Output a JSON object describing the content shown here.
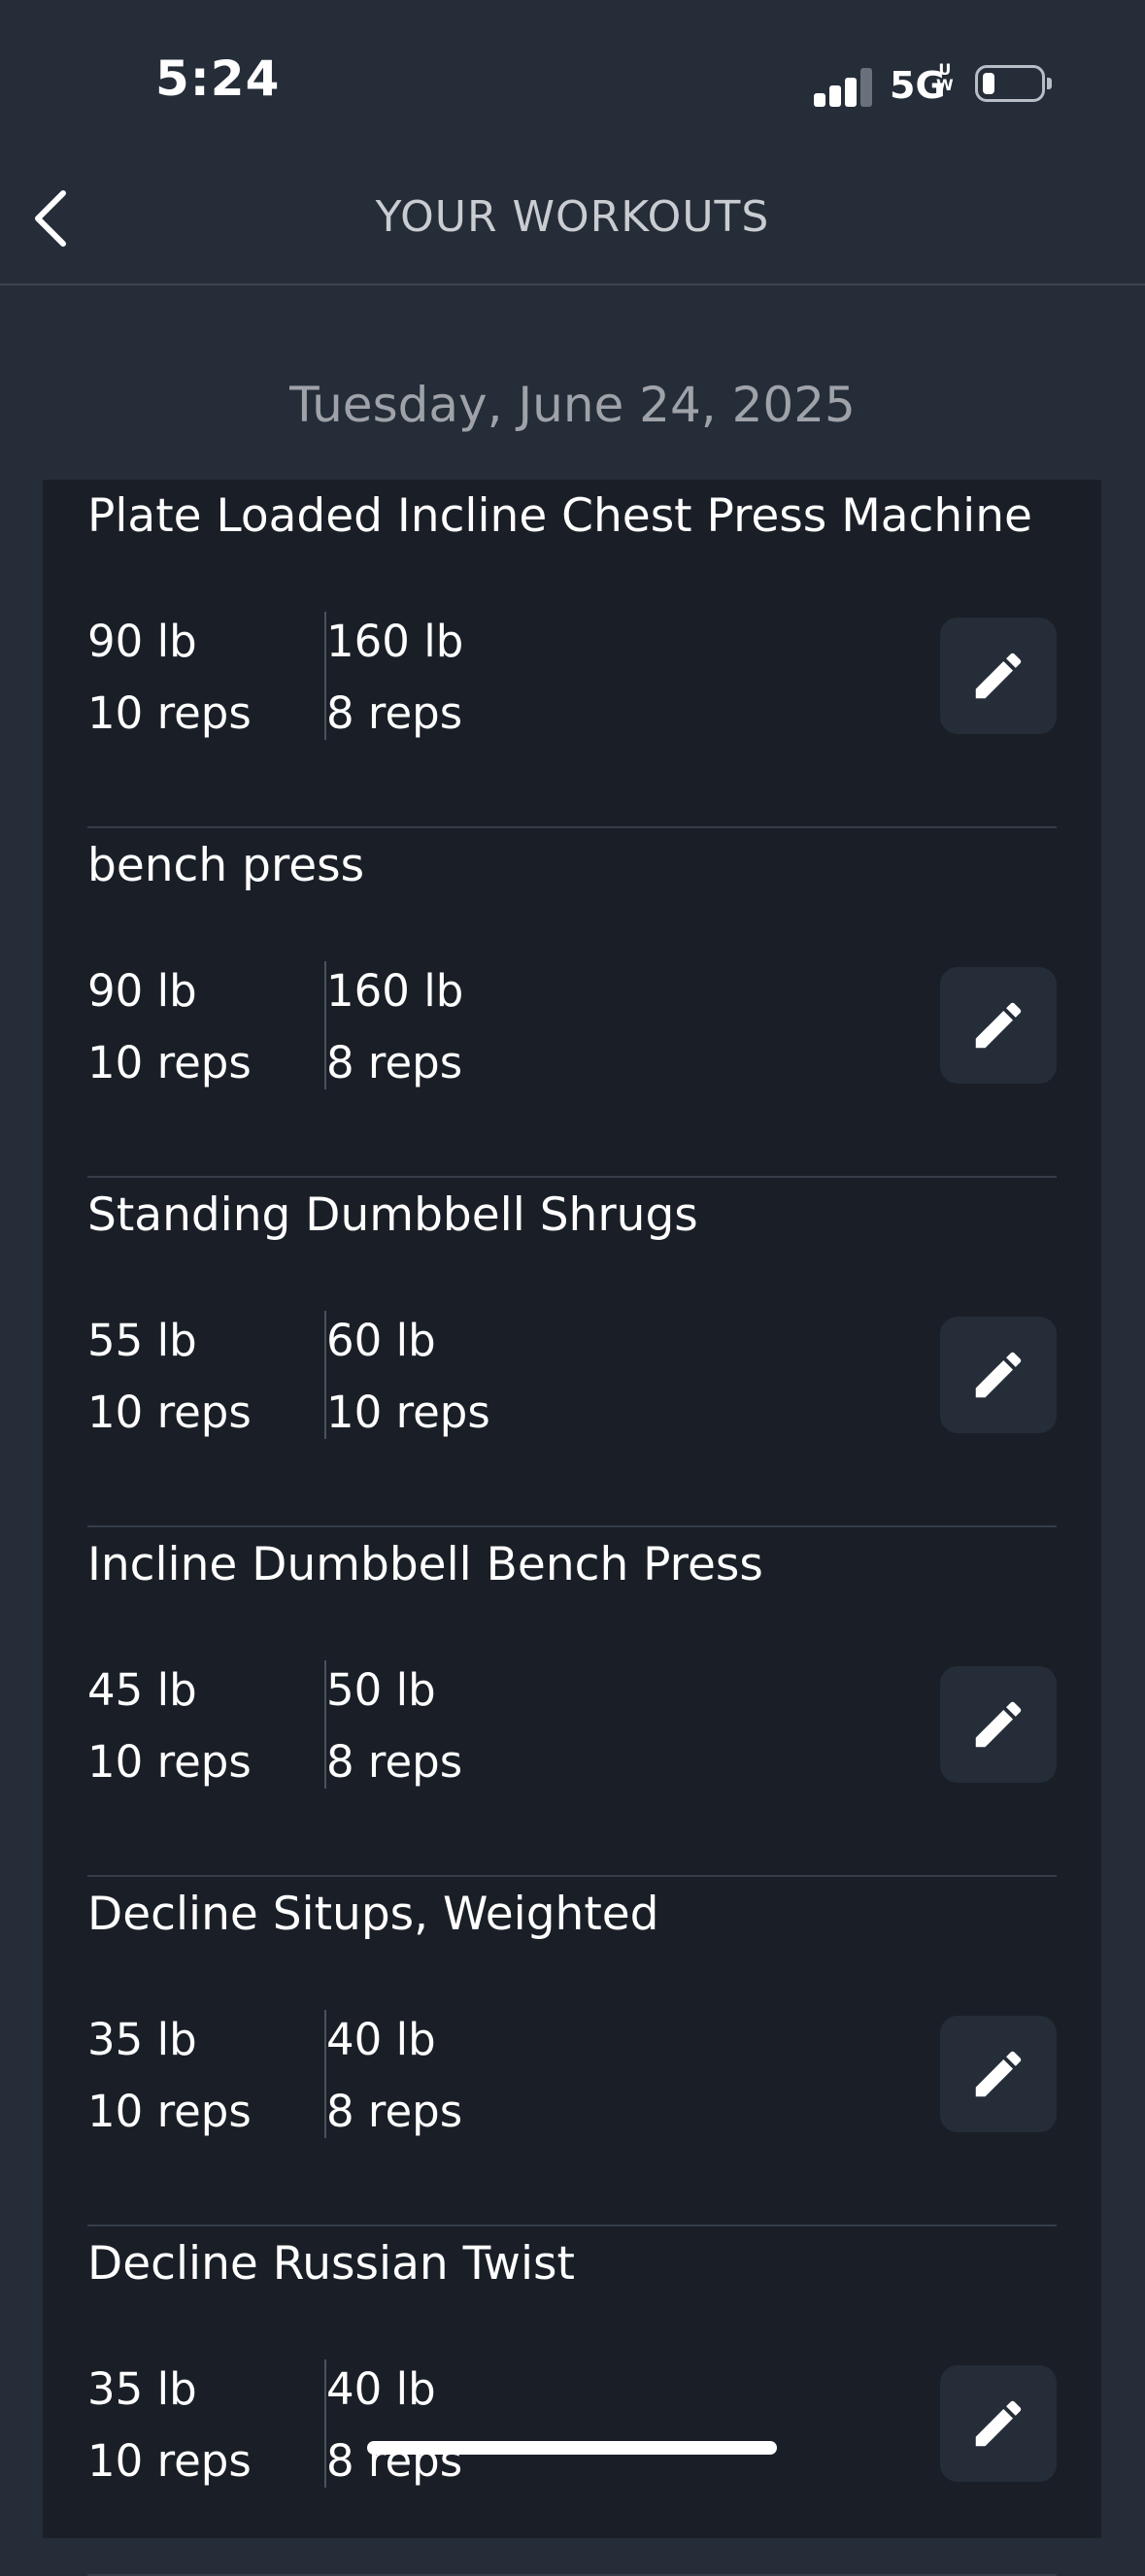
{
  "status_bar": {
    "time": "5:24",
    "network": "5G",
    "network_sup": "U\nW"
  },
  "nav": {
    "title": "YOUR WORKOUTS"
  },
  "date_header": "Tuesday, June 24, 2025",
  "workouts": [
    {
      "name": "Plate Loaded Incline Chest Press Machine",
      "sets": [
        {
          "weight": "90 lb",
          "reps": "10 reps"
        },
        {
          "weight": "160 lb",
          "reps": "8 reps"
        }
      ]
    },
    {
      "name": "bench press",
      "sets": [
        {
          "weight": "90 lb",
          "reps": "10 reps"
        },
        {
          "weight": "160 lb",
          "reps": "8 reps"
        }
      ]
    },
    {
      "name": "Standing Dumbbell Shrugs",
      "sets": [
        {
          "weight": "55 lb",
          "reps": "10 reps"
        },
        {
          "weight": "60 lb",
          "reps": "10 reps"
        }
      ]
    },
    {
      "name": "Incline Dumbbell Bench Press",
      "sets": [
        {
          "weight": "45 lb",
          "reps": "10 reps"
        },
        {
          "weight": "50 lb",
          "reps": "8 reps"
        }
      ]
    },
    {
      "name": "Decline Situps, Weighted",
      "sets": [
        {
          "weight": "35 lb",
          "reps": "10 reps"
        },
        {
          "weight": "40 lb",
          "reps": "8 reps"
        }
      ]
    },
    {
      "name": "Decline Russian Twist",
      "sets": [
        {
          "weight": "35 lb",
          "reps": "10 reps"
        },
        {
          "weight": "40 lb",
          "reps": "8 reps"
        }
      ]
    }
  ],
  "colors": {
    "background": "#252d38",
    "card": "#1a1f27",
    "edit_button": "#252d38",
    "title_text": "#c9ccd1",
    "date_text": "#9fa3a9"
  },
  "icons": {
    "back": "chevron-left-icon",
    "edit": "pencil-icon",
    "signal": "cellular-signal-icon",
    "battery": "battery-icon"
  }
}
